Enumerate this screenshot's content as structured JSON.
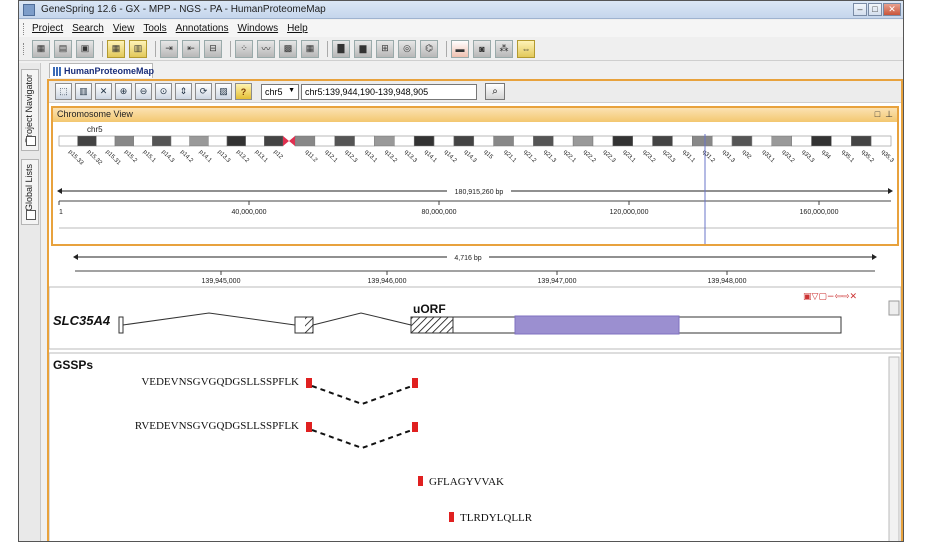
{
  "window": {
    "title": "GeneSpring 12.6 - GX - MPP - NGS - PA - HumanProteomeMap"
  },
  "menus": [
    "Project",
    "Search",
    "View",
    "Tools",
    "Annotations",
    "Windows",
    "Help"
  ],
  "sidebar": {
    "tabs": [
      "Project Navigator",
      "Global Lists"
    ]
  },
  "document_tab": {
    "label": "HumanProteomeMap"
  },
  "viewer": {
    "chromosome_select": "chr5",
    "coordinates": "chr5:139,944,190-139,948,905",
    "chromosome_view": {
      "title": "Chromosome View",
      "chromosome_label": "chr5",
      "span_label": "180,915,260 bp",
      "axis_ticks": [
        "1",
        "40,000,000",
        "80,000,000",
        "120,000,000",
        "160,000,000"
      ],
      "bands": [
        "p15.33",
        "p15.32",
        "p15.31",
        "p15.2",
        "p15.1",
        "p14.3",
        "p14.2",
        "p14.1",
        "p13.3",
        "p13.2",
        "p13.1",
        "p12",
        "q11.2",
        "q12.1",
        "q12.3",
        "q13.1",
        "q13.2",
        "q13.3",
        "q14.1",
        "q14.2",
        "q14.3",
        "q15",
        "q21.1",
        "q21.2",
        "q21.3",
        "q22.1",
        "q22.2",
        "q22.3",
        "q23.1",
        "q23.2",
        "q23.3",
        "q31.1",
        "q31.2",
        "q31.3",
        "q32",
        "q33.1",
        "q33.2",
        "q33.3",
        "q34",
        "q35.1",
        "q35.2",
        "q35.3"
      ]
    },
    "region": {
      "span_label": "4,716 bp",
      "axis_ticks": [
        "139,945,000",
        "139,946,000",
        "139,947,000",
        "139,948,000"
      ]
    },
    "gene": {
      "name": "SLC35A4",
      "uorf_label": "uORF"
    },
    "gssps": {
      "title": "GSSPs",
      "peptides": [
        "VEDEVNSGVGQDGSLLSSPFLK",
        "RVEDEVNSGVGQDGSLLSSPFLK",
        "GFLAGYVVAK",
        "TLRDYLQLLR"
      ]
    }
  },
  "colors": {
    "accent_orange": "#e8a23d",
    "cds_purple": "#9b8fd0",
    "peptide_red": "#e02020",
    "centromere": "#e03050"
  }
}
